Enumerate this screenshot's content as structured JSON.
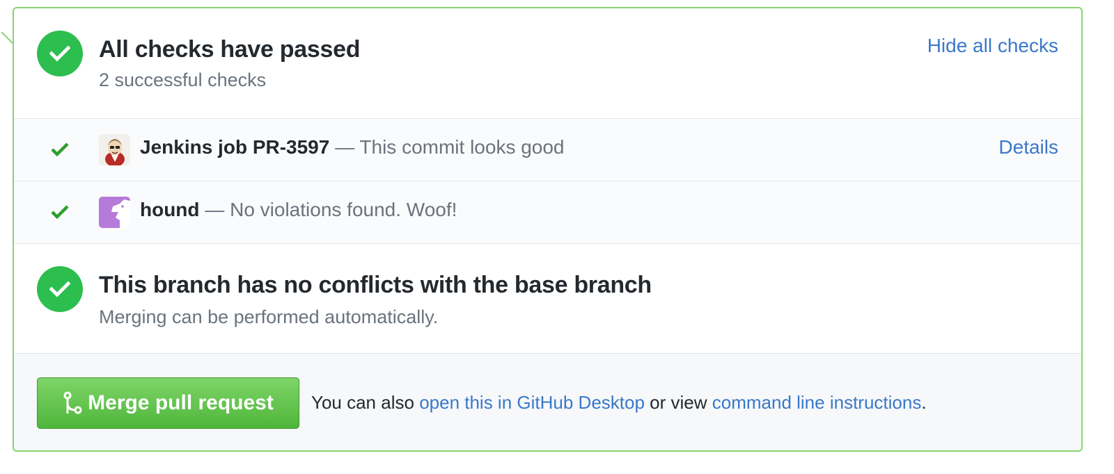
{
  "colors": {
    "success": "#2cbe4e",
    "check_green": "#2e9e2e",
    "link": "#3a78c9",
    "panel_border": "#87d46f",
    "merge_button": "#4fb63b"
  },
  "checks": {
    "title": "All checks have passed",
    "subtitle": "2 successful checks",
    "toggle_label": "Hide all checks",
    "status_icon": "check-circle-icon",
    "items": [
      {
        "context": "Jenkins job PR-3597",
        "description": "— This commit looks good",
        "avatar": "jenkins-avatar",
        "status_icon": "check-icon",
        "details_label": "Details"
      },
      {
        "context": "hound",
        "description": "— No violations found. Woof!",
        "avatar": "hound-avatar",
        "status_icon": "check-icon"
      }
    ]
  },
  "merge": {
    "title": "This branch has no conflicts with the base branch",
    "subtitle": "Merging can be performed automatically.",
    "status_icon": "check-circle-icon",
    "button_icon": "git-merge-icon",
    "button_label": "Merge pull request",
    "footer_prefix": "You can also",
    "footer_link_desktop": "open this in GitHub Desktop",
    "footer_middle": "or view",
    "footer_link_cli": "command line instructions",
    "footer_suffix": "."
  }
}
